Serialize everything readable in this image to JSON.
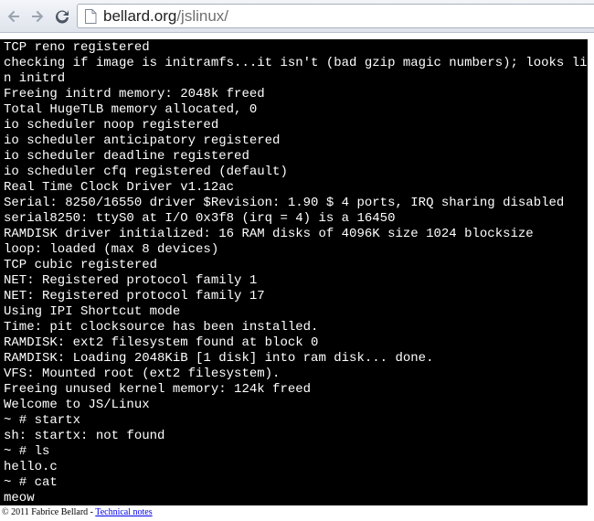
{
  "browser": {
    "url_host": "bellard.org",
    "url_path": "/jslinux/",
    "icons": {
      "back": "back-arrow-icon",
      "forward": "forward-arrow-icon",
      "reload": "reload-icon",
      "page": "page-icon"
    }
  },
  "terminal": {
    "background": "#000000",
    "foreground": "#ffffff",
    "lines": [
      "TCP reno registered",
      "checking if image is initramfs...it isn't (bad gzip magic numbers); looks like a",
      "n initrd",
      "Freeing initrd memory: 2048k freed",
      "Total HugeTLB memory allocated, 0",
      "io scheduler noop registered",
      "io scheduler anticipatory registered",
      "io scheduler deadline registered",
      "io scheduler cfq registered (default)",
      "Real Time Clock Driver v1.12ac",
      "Serial: 8250/16550 driver $Revision: 1.90 $ 4 ports, IRQ sharing disabled",
      "serial8250: ttyS0 at I/O 0x3f8 (irq = 4) is a 16450",
      "RAMDISK driver initialized: 16 RAM disks of 4096K size 1024 blocksize",
      "loop: loaded (max 8 devices)",
      "TCP cubic registered",
      "NET: Registered protocol family 1",
      "NET: Registered protocol family 17",
      "Using IPI Shortcut mode",
      "Time: pit clocksource has been installed.",
      "RAMDISK: ext2 filesystem found at block 0",
      "RAMDISK: Loading 2048KiB [1 disk] into ram disk... done.",
      "VFS: Mounted root (ext2 filesystem).",
      "Freeing unused kernel memory: 124k freed",
      "Welcome to JS/Linux",
      "~ # startx",
      "sh: startx: not found",
      "~ # ls",
      "hello.c",
      "~ # cat",
      "meow"
    ]
  },
  "footer": {
    "copyright": "© 2011 Fabrice Bellard - ",
    "link_label": "Technical notes"
  }
}
